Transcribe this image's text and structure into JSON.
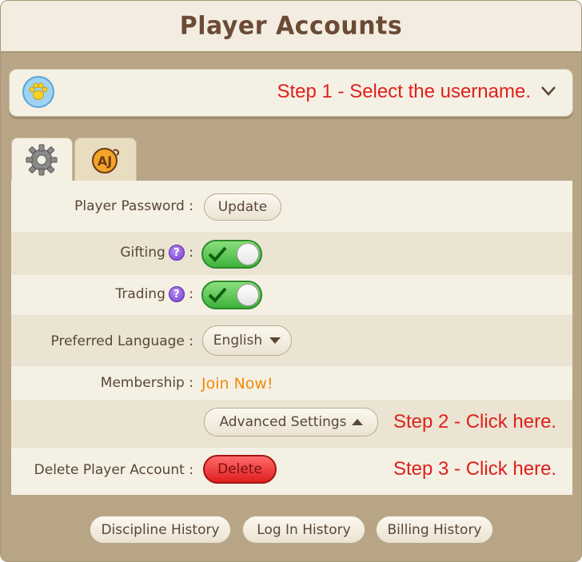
{
  "window": {
    "title": "Player Accounts"
  },
  "user_select": {
    "icon": "paw-icon",
    "prompt": "Step 1 - Select the username.",
    "dropdown_icon": "chevron-down-icon"
  },
  "tabs": [
    {
      "icon": "gear-icon",
      "selected": true
    },
    {
      "icon": "aj-logo-icon",
      "selected": false
    }
  ],
  "settings": {
    "password": {
      "label": "Player Password",
      "button": "Update"
    },
    "gifting": {
      "label": "Gifting",
      "enabled": true
    },
    "trading": {
      "label": "Trading",
      "enabled": true
    },
    "language": {
      "label": "Preferred Language",
      "value": "English"
    },
    "membership": {
      "label": "Membership",
      "link": "Join Now!"
    },
    "advanced": {
      "button": "Advanced Settings",
      "note": "Step 2 - Click here."
    },
    "delete": {
      "label": "Delete Player Account",
      "button": "Delete",
      "note": "Step 3 - Click here."
    },
    "colon": ":",
    "help_glyph": "?"
  },
  "footer": {
    "discipline": "Discipline History",
    "login": "Log In History",
    "billing": "Billing History"
  },
  "colors": {
    "step_text": "#e0201c",
    "join_link": "#f28a0c",
    "toggle_on": "#3fb23a",
    "delete_button": "#e01e1e"
  }
}
